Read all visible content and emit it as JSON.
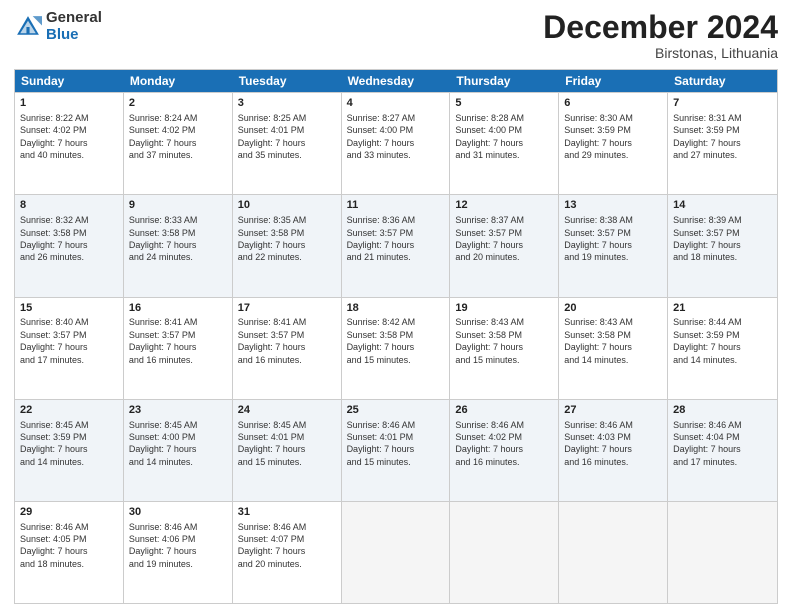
{
  "logo": {
    "general": "General",
    "blue": "Blue"
  },
  "title": "December 2024",
  "location": "Birstonas, Lithuania",
  "days_of_week": [
    "Sunday",
    "Monday",
    "Tuesday",
    "Wednesday",
    "Thursday",
    "Friday",
    "Saturday"
  ],
  "weeks": [
    [
      {
        "day": "1",
        "info": "Sunrise: 8:22 AM\nSunset: 4:02 PM\nDaylight: 7 hours\nand 40 minutes."
      },
      {
        "day": "2",
        "info": "Sunrise: 8:24 AM\nSunset: 4:02 PM\nDaylight: 7 hours\nand 37 minutes."
      },
      {
        "day": "3",
        "info": "Sunrise: 8:25 AM\nSunset: 4:01 PM\nDaylight: 7 hours\nand 35 minutes."
      },
      {
        "day": "4",
        "info": "Sunrise: 8:27 AM\nSunset: 4:00 PM\nDaylight: 7 hours\nand 33 minutes."
      },
      {
        "day": "5",
        "info": "Sunrise: 8:28 AM\nSunset: 4:00 PM\nDaylight: 7 hours\nand 31 minutes."
      },
      {
        "day": "6",
        "info": "Sunrise: 8:30 AM\nSunset: 3:59 PM\nDaylight: 7 hours\nand 29 minutes."
      },
      {
        "day": "7",
        "info": "Sunrise: 8:31 AM\nSunset: 3:59 PM\nDaylight: 7 hours\nand 27 minutes."
      }
    ],
    [
      {
        "day": "8",
        "info": "Sunrise: 8:32 AM\nSunset: 3:58 PM\nDaylight: 7 hours\nand 26 minutes."
      },
      {
        "day": "9",
        "info": "Sunrise: 8:33 AM\nSunset: 3:58 PM\nDaylight: 7 hours\nand 24 minutes."
      },
      {
        "day": "10",
        "info": "Sunrise: 8:35 AM\nSunset: 3:58 PM\nDaylight: 7 hours\nand 22 minutes."
      },
      {
        "day": "11",
        "info": "Sunrise: 8:36 AM\nSunset: 3:57 PM\nDaylight: 7 hours\nand 21 minutes."
      },
      {
        "day": "12",
        "info": "Sunrise: 8:37 AM\nSunset: 3:57 PM\nDaylight: 7 hours\nand 20 minutes."
      },
      {
        "day": "13",
        "info": "Sunrise: 8:38 AM\nSunset: 3:57 PM\nDaylight: 7 hours\nand 19 minutes."
      },
      {
        "day": "14",
        "info": "Sunrise: 8:39 AM\nSunset: 3:57 PM\nDaylight: 7 hours\nand 18 minutes."
      }
    ],
    [
      {
        "day": "15",
        "info": "Sunrise: 8:40 AM\nSunset: 3:57 PM\nDaylight: 7 hours\nand 17 minutes."
      },
      {
        "day": "16",
        "info": "Sunrise: 8:41 AM\nSunset: 3:57 PM\nDaylight: 7 hours\nand 16 minutes."
      },
      {
        "day": "17",
        "info": "Sunrise: 8:41 AM\nSunset: 3:57 PM\nDaylight: 7 hours\nand 16 minutes."
      },
      {
        "day": "18",
        "info": "Sunrise: 8:42 AM\nSunset: 3:58 PM\nDaylight: 7 hours\nand 15 minutes."
      },
      {
        "day": "19",
        "info": "Sunrise: 8:43 AM\nSunset: 3:58 PM\nDaylight: 7 hours\nand 15 minutes."
      },
      {
        "day": "20",
        "info": "Sunrise: 8:43 AM\nSunset: 3:58 PM\nDaylight: 7 hours\nand 14 minutes."
      },
      {
        "day": "21",
        "info": "Sunrise: 8:44 AM\nSunset: 3:59 PM\nDaylight: 7 hours\nand 14 minutes."
      }
    ],
    [
      {
        "day": "22",
        "info": "Sunrise: 8:45 AM\nSunset: 3:59 PM\nDaylight: 7 hours\nand 14 minutes."
      },
      {
        "day": "23",
        "info": "Sunrise: 8:45 AM\nSunset: 4:00 PM\nDaylight: 7 hours\nand 14 minutes."
      },
      {
        "day": "24",
        "info": "Sunrise: 8:45 AM\nSunset: 4:01 PM\nDaylight: 7 hours\nand 15 minutes."
      },
      {
        "day": "25",
        "info": "Sunrise: 8:46 AM\nSunset: 4:01 PM\nDaylight: 7 hours\nand 15 minutes."
      },
      {
        "day": "26",
        "info": "Sunrise: 8:46 AM\nSunset: 4:02 PM\nDaylight: 7 hours\nand 16 minutes."
      },
      {
        "day": "27",
        "info": "Sunrise: 8:46 AM\nSunset: 4:03 PM\nDaylight: 7 hours\nand 16 minutes."
      },
      {
        "day": "28",
        "info": "Sunrise: 8:46 AM\nSunset: 4:04 PM\nDaylight: 7 hours\nand 17 minutes."
      }
    ],
    [
      {
        "day": "29",
        "info": "Sunrise: 8:46 AM\nSunset: 4:05 PM\nDaylight: 7 hours\nand 18 minutes."
      },
      {
        "day": "30",
        "info": "Sunrise: 8:46 AM\nSunset: 4:06 PM\nDaylight: 7 hours\nand 19 minutes."
      },
      {
        "day": "31",
        "info": "Sunrise: 8:46 AM\nSunset: 4:07 PM\nDaylight: 7 hours\nand 20 minutes."
      },
      {
        "day": "",
        "info": ""
      },
      {
        "day": "",
        "info": ""
      },
      {
        "day": "",
        "info": ""
      },
      {
        "day": "",
        "info": ""
      }
    ]
  ]
}
